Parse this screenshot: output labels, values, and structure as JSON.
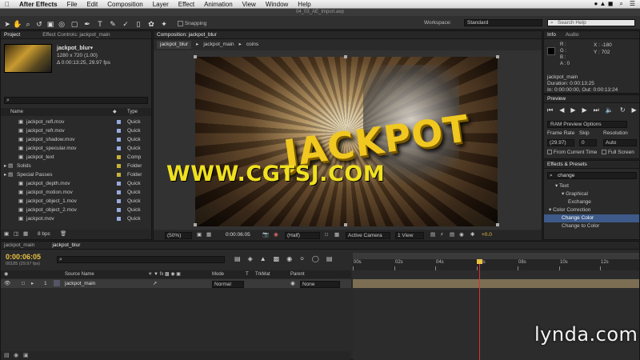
{
  "menubar": {
    "app": "After Effects",
    "items": [
      "File",
      "Edit",
      "Composition",
      "Layer",
      "Effect",
      "Animation",
      "View",
      "Window",
      "Help"
    ]
  },
  "toolbar": {
    "file_title": "04_03_AE_Import.aep",
    "snapping": "Snapping",
    "workspace_label": "Workspace:",
    "workspace_value": "Standard",
    "search_placeholder": "Search Help"
  },
  "project": {
    "tab_project": "Project",
    "tab_effect_controls": "Effect Controls: jackpot_main",
    "comp_name": "jackpot_blur▾",
    "comp_size": "1280 x 720 (1.00)",
    "comp_duration": "Δ 0:00:13:25, 29.97 fps",
    "search_icon_text": "⌕",
    "col_name": "Name",
    "col_type": "Type",
    "items": [
      {
        "name": "jackpot_refl.mov",
        "type": "Quick",
        "color": "#9ad"
      },
      {
        "name": "jackpot_refr.mov",
        "type": "Quick",
        "color": "#9ad"
      },
      {
        "name": "jackpot_shadow.mov",
        "type": "Quick",
        "color": "#9ad"
      },
      {
        "name": "jackpot_specular.mov",
        "type": "Quick",
        "color": "#9ad"
      },
      {
        "name": "jackpot_text",
        "type": "Comp",
        "color": "#c8b23a"
      },
      {
        "name": "Solids",
        "type": "Folder",
        "color": "#c8b23a"
      },
      {
        "name": "Special Passes",
        "type": "Folder",
        "color": "#c8b23a"
      },
      {
        "name": "jackpot_depth.mov",
        "type": "Quick",
        "color": "#9ad"
      },
      {
        "name": "jackpot_motion.mov",
        "type": "Quick",
        "color": "#9ad"
      },
      {
        "name": "jackpot_object_1.mov",
        "type": "Quick",
        "color": "#9ad"
      },
      {
        "name": "jackpot_object_2.mov",
        "type": "Quick",
        "color": "#9ad"
      },
      {
        "name": "jackpot.mov",
        "type": "Quick",
        "color": "#9ad"
      }
    ],
    "bpc": "8 bpc"
  },
  "composition": {
    "tab": "Composition: jackpot_blur",
    "crumb_1": "jackpot_blur",
    "crumb_2": "jackpot_main",
    "crumb_3": "coins",
    "zoom": "(50%)",
    "timecode": "0:00:06:05",
    "resolution": "(Half)",
    "camera": "Active Camera",
    "view": "1 View",
    "exposure": "+0.0",
    "render_text": "JACKPOT",
    "watermark": "WWW.CGTSJ.COM"
  },
  "info": {
    "tab_info": "Info",
    "tab_audio": "Audio",
    "r": "R :",
    "g": "G :",
    "b": "B :",
    "a": "A : 0",
    "x": "X : -180",
    "y": "Y : 702",
    "layer": "jackpot_main",
    "duration": "Duration: 0:00:13:25",
    "inout": "In: 0:00:00:00, Out: 0:00:13:24"
  },
  "preview": {
    "tab": "Preview",
    "ram": "RAM Preview Options",
    "frame_rate_label": "Frame Rate",
    "skip_label": "Skip",
    "resolution_label": "Resolution",
    "frame_rate": "(29.97)",
    "skip": "0",
    "resolution": "Auto",
    "from_current": "From Current Time",
    "full_screen": "Full Screen"
  },
  "effects": {
    "tab": "Effects & Presets",
    "search": "change",
    "items": [
      {
        "label": "▾ Text",
        "indent": 1,
        "sel": false
      },
      {
        "label": "▾ Graphical",
        "indent": 2,
        "sel": false
      },
      {
        "label": "Exchange",
        "indent": 3,
        "sel": false
      },
      {
        "label": "▾ Color Correction",
        "indent": 0,
        "sel": false
      },
      {
        "label": "Change Color",
        "indent": 2,
        "sel": true
      },
      {
        "label": "Change to Color",
        "indent": 2,
        "sel": false
      }
    ]
  },
  "timeline": {
    "tab_1": "jackpot_main",
    "tab_2": "jackpot_blur",
    "timecode": "0:00:06:05",
    "frames": "00185 (29.97 fps)",
    "col_source": "Source Name",
    "col_mode": "Mode",
    "col_t": "T",
    "col_trkmat": "TrkMat",
    "col_parent": "Parent",
    "layer_num": "1",
    "layer_name": "jackpot_main",
    "layer_mode": "Normal",
    "layer_parent": "None",
    "ruler": [
      "00s",
      "02s",
      "04s",
      "06s",
      "08s",
      "10s",
      "12s"
    ],
    "playhead_fraction": 0.44,
    "ruler_seconds": 13.9
  },
  "branding": {
    "logo": "lynda.com"
  }
}
